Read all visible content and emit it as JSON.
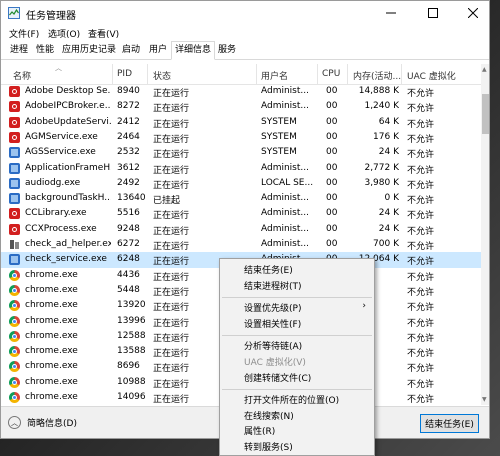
{
  "window": {
    "title": "任务管理器"
  },
  "menu": [
    "文件(F)",
    "选项(O)",
    "查看(V)"
  ],
  "tabs": [
    "进程",
    "性能",
    "应用历史记录",
    "启动",
    "用户",
    "详细信息",
    "服务"
  ],
  "active_tab": "详细信息",
  "columns": [
    "名称",
    "PID",
    "状态",
    "用户名",
    "CPU",
    "内存(活动...",
    "UAC 虚拟化"
  ],
  "rows": [
    {
      "icon": "adobe-icon",
      "name": "Adobe Desktop Se...",
      "pid": "8940",
      "status": "正在运行",
      "user": "Administ...",
      "cpu": "00",
      "mem": "14,888 K",
      "uac": "不允许"
    },
    {
      "icon": "adobe-icon",
      "name": "AdobeIPCBroker.e...",
      "pid": "8272",
      "status": "正在运行",
      "user": "Administ...",
      "cpu": "00",
      "mem": "1,240 K",
      "uac": "不允许"
    },
    {
      "icon": "adobe-icon",
      "name": "AdobeUpdateServi...",
      "pid": "2412",
      "status": "正在运行",
      "user": "SYSTEM",
      "cpu": "00",
      "mem": "64 K",
      "uac": "不允许"
    },
    {
      "icon": "adobe-icon",
      "name": "AGMService.exe",
      "pid": "2464",
      "status": "正在运行",
      "user": "SYSTEM",
      "cpu": "00",
      "mem": "176 K",
      "uac": "不允许"
    },
    {
      "icon": "app-window-icon",
      "name": "AGSService.exe",
      "pid": "2532",
      "status": "正在运行",
      "user": "SYSTEM",
      "cpu": "00",
      "mem": "24 K",
      "uac": "不允许"
    },
    {
      "icon": "app-window-icon",
      "name": "ApplicationFrameH...",
      "pid": "3612",
      "status": "正在运行",
      "user": "Administ...",
      "cpu": "00",
      "mem": "2,772 K",
      "uac": "不允许"
    },
    {
      "icon": "app-window-icon",
      "name": "audiodg.exe",
      "pid": "2492",
      "status": "正在运行",
      "user": "LOCAL SE...",
      "cpu": "00",
      "mem": "3,980 K",
      "uac": "不允许"
    },
    {
      "icon": "app-window-icon",
      "name": "backgroundTaskH...",
      "pid": "13640",
      "status": "已挂起",
      "user": "Administ...",
      "cpu": "00",
      "mem": "0 K",
      "uac": "不允许"
    },
    {
      "icon": "adobe-icon",
      "name": "CCLibrary.exe",
      "pid": "5516",
      "status": "正在运行",
      "user": "Administ...",
      "cpu": "00",
      "mem": "24 K",
      "uac": "不允许"
    },
    {
      "icon": "adobe-icon",
      "name": "CCXProcess.exe",
      "pid": "9248",
      "status": "正在运行",
      "user": "Administ...",
      "cpu": "00",
      "mem": "24 K",
      "uac": "不允许"
    },
    {
      "icon": "tools-icon",
      "name": "check_ad_helper.exe",
      "pid": "6272",
      "status": "正在运行",
      "user": "Administ...",
      "cpu": "00",
      "mem": "700 K",
      "uac": "不允许"
    },
    {
      "icon": "app-window-icon",
      "name": "check_service.exe",
      "pid": "6248",
      "status": "正在运行",
      "user": "Administ...",
      "cpu": "00",
      "mem": "12,064 K",
      "uac": "不允许"
    },
    {
      "icon": "chrome-icon",
      "name": "chrome.exe",
      "pid": "4436",
      "status": "正在运行",
      "user": "",
      "cpu": "",
      "mem": "",
      "uac": "不允许"
    },
    {
      "icon": "chrome-icon",
      "name": "chrome.exe",
      "pid": "5448",
      "status": "正在运行",
      "user": "",
      "cpu": "",
      "mem": "",
      "uac": "不允许"
    },
    {
      "icon": "chrome-icon",
      "name": "chrome.exe",
      "pid": "13920",
      "status": "正在运行",
      "user": "",
      "cpu": "",
      "mem": "",
      "uac": "不允许"
    },
    {
      "icon": "chrome-icon",
      "name": "chrome.exe",
      "pid": "13996",
      "status": "正在运行",
      "user": "",
      "cpu": "",
      "mem": "",
      "uac": "不允许"
    },
    {
      "icon": "chrome-icon",
      "name": "chrome.exe",
      "pid": "12588",
      "status": "正在运行",
      "user": "",
      "cpu": "",
      "mem": "",
      "uac": "不允许"
    },
    {
      "icon": "chrome-icon",
      "name": "chrome.exe",
      "pid": "13588",
      "status": "正在运行",
      "user": "",
      "cpu": "",
      "mem": "",
      "uac": "不允许"
    },
    {
      "icon": "chrome-icon",
      "name": "chrome.exe",
      "pid": "8696",
      "status": "正在运行",
      "user": "",
      "cpu": "",
      "mem": "",
      "uac": "不允许"
    },
    {
      "icon": "chrome-icon",
      "name": "chrome.exe",
      "pid": "10988",
      "status": "正在运行",
      "user": "",
      "cpu": "",
      "mem": "",
      "uac": "不允许"
    },
    {
      "icon": "chrome-icon",
      "name": "chrome.exe",
      "pid": "14096",
      "status": "正在运行",
      "user": "",
      "cpu": "",
      "mem": "",
      "uac": "不允许"
    }
  ],
  "selected_row_index": 11,
  "context_menu": [
    {
      "label": "结束任务(E)",
      "enabled": true
    },
    {
      "label": "结束进程树(T)",
      "enabled": true
    },
    {
      "separator": true
    },
    {
      "label": "设置优先级(P)",
      "enabled": true,
      "submenu": true
    },
    {
      "label": "设置相关性(F)",
      "enabled": true
    },
    {
      "separator": true
    },
    {
      "label": "分析等待链(A)",
      "enabled": true
    },
    {
      "label": "UAC 虚拟化(V)",
      "enabled": false
    },
    {
      "label": "创建转储文件(C)",
      "enabled": true
    },
    {
      "separator": true
    },
    {
      "label": "打开文件所在的位置(O)",
      "enabled": true
    },
    {
      "label": "在线搜索(N)",
      "enabled": true
    },
    {
      "label": "属性(R)",
      "enabled": true
    },
    {
      "label": "转到服务(S)",
      "enabled": true
    }
  ],
  "footer": {
    "less_details": "简略信息(D)",
    "end_task": "结束任务(E)"
  },
  "colors": {
    "selection": "#cce8ff",
    "accent_border": "#0078d7"
  }
}
